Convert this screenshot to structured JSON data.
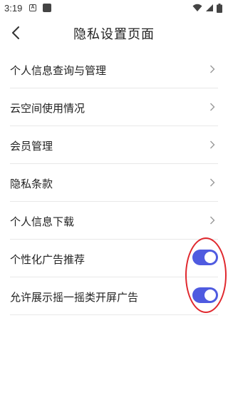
{
  "status_bar": {
    "time": "3:19",
    "left_icons": [
      "a-notification-icon",
      "square-notification-icon"
    ],
    "right_icons": [
      "wifi-icon",
      "signal-icon",
      "battery-icon"
    ]
  },
  "header": {
    "title": "隐私设置页面",
    "back_icon": "chevron-left-icon"
  },
  "settings": {
    "items": [
      {
        "label": "个人信息查询与管理",
        "control": "chevron"
      },
      {
        "label": "云空间使用情况",
        "control": "chevron"
      },
      {
        "label": "会员管理",
        "control": "chevron"
      },
      {
        "label": "隐私条款",
        "control": "chevron"
      },
      {
        "label": "个人信息下载",
        "control": "chevron"
      },
      {
        "label": "个性化广告推荐",
        "control": "toggle",
        "on": true
      },
      {
        "label": "允许展示摇一摇类开屏广告",
        "control": "toggle",
        "on": true
      }
    ]
  },
  "colors": {
    "toggle_on": "#4f5be0",
    "annotation": "#e0282e",
    "divider": "#e8e8e8"
  }
}
